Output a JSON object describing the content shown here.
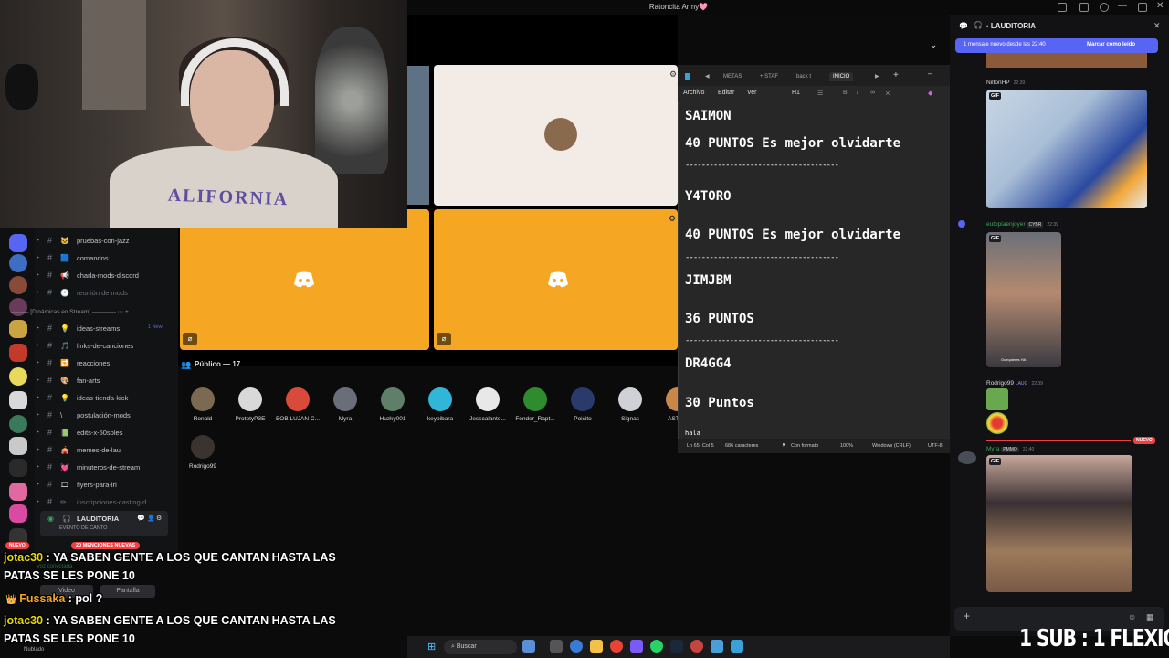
{
  "window_title": "Ratoncita Army🩷",
  "public_header": "Público — 17",
  "members": [
    {
      "name": "Ronald",
      "color": "#7b6a52"
    },
    {
      "name": "PrototyP3E",
      "color": "#d9d9d9"
    },
    {
      "name": "BOB LUJAN C...",
      "color": "#d94a3a"
    },
    {
      "name": "Myra",
      "color": "#6a6e78"
    },
    {
      "name": "Huzky001",
      "color": "#5f7f6a"
    },
    {
      "name": "keypibara",
      "color": "#2fb6d8"
    },
    {
      "name": "Jesscalante...",
      "color": "#e8e8e8"
    },
    {
      "name": "Fonder_Rapt...",
      "color": "#2e8b2e"
    },
    {
      "name": "Poicito",
      "color": "#2a3a6a"
    },
    {
      "name": "Signas",
      "color": "#cfd1d6"
    },
    {
      "name": "ASTER",
      "color": "#c9884a"
    },
    {
      "name": "Rodrigo99",
      "color": "#3a3330"
    }
  ],
  "channels": [
    {
      "emoji": "🐱",
      "name": "pruebas-con-jazz",
      "muted": false
    },
    {
      "emoji": "🟦",
      "name": "comandos",
      "muted": false
    },
    {
      "emoji": "📢",
      "name": "charla-mods-discord",
      "muted": false
    },
    {
      "emoji": "🕐",
      "name": "reunión de mods",
      "muted": true
    },
    {
      "emoji": "💡",
      "name": "ideas-streams",
      "muted": false
    },
    {
      "emoji": "🎵",
      "name": "links-de-canciones",
      "muted": false
    },
    {
      "emoji": "🔁",
      "name": "reacciones",
      "muted": false
    },
    {
      "emoji": "🎨",
      "name": "fan-arts",
      "muted": false
    },
    {
      "emoji": "💡",
      "name": "ideas-tienda-kick",
      "muted": false
    },
    {
      "emoji": "\\",
      "name": "postulación-mods",
      "muted": false
    },
    {
      "emoji": "📗",
      "name": "edits-x-50soles",
      "muted": false
    },
    {
      "emoji": "🎪",
      "name": "memes-de-lau",
      "muted": false
    },
    {
      "emoji": "💓",
      "name": "minuteros-de-stream",
      "muted": false
    },
    {
      "emoji": "🎞",
      "name": "flyers-para-irl",
      "muted": false
    },
    {
      "emoji": "✏",
      "name": "inscripciones-casting-d...",
      "muted": true
    }
  ],
  "channel_separator": "Dinámicas en Stream",
  "ideas_new_badge": "1 New",
  "voice": {
    "name": "LAUDITORIA",
    "sub": "EVENTO DE CANTO",
    "connected": "Voz conectada",
    "video": "Video",
    "screen": "Pantalla"
  },
  "badges": {
    "nuevo": "NUEVO",
    "mentions": "20 MENCIONES NUEVAS"
  },
  "overlay_chat": [
    {
      "user": "jotac30",
      "line1": " : YA SABEN GENTE A LOS QUE CANTAN HASTA LAS",
      "line2": "PATAS SE LES PONE 10"
    },
    {
      "user": "Fussaka",
      "line1": " : pol ?"
    },
    {
      "user": "jotac30",
      "line1": " : YA SABEN GENTE A LOS QUE CANTAN HASTA LAS",
      "line2": "PATAS SE LES PONE 10"
    }
  ],
  "editor": {
    "tabs": [
      "METAS",
      "+ STAF",
      "back t",
      "INICIO"
    ],
    "menu": [
      "Archivo",
      "Editar",
      "Ver"
    ],
    "heading": "H1",
    "lines": [
      {
        "text": "SAIMON"
      },
      {
        "text": "40 PUNTOS Es mejor olvidarte"
      },
      {
        "text": "Y4TORO"
      },
      {
        "text": "40 PUNTOS Es mejor olvidarte"
      },
      {
        "text": "JIMJBM"
      },
      {
        "text": "36 PUNTOS"
      },
      {
        "text": "DR4GG4"
      },
      {
        "text": "30 Puntos"
      }
    ],
    "rule": "--------------------------------------",
    "cursor_text": "hala",
    "status": {
      "pos": "Ln 65, Col 5",
      "chars": "686 caracteres",
      "format": "Con formato",
      "zoom": "100%",
      "eol": "Windows (CRLF)",
      "enc": "UTF-8"
    }
  },
  "chat": {
    "channel": "LAUDITORIA",
    "new_msg": "1 mensaje nuevo desde las 22:40",
    "mark_read": "Marcar como leído",
    "messages": [
      {
        "user": "NiltonHP",
        "time": "22:39"
      },
      {
        "user": "eutopiaenjoyer",
        "tag": "CYBR",
        "time": "22:39"
      },
      {
        "user": "Rodrigo99",
        "tag": "LAUG",
        "time": "22:39"
      },
      {
        "user": "Myra",
        "tag": "PMMO",
        "time": "22:40"
      }
    ],
    "gif_label": "GIF",
    "nuevo": "NUEVO",
    "caption": "Ouequieres HA"
  },
  "taskbar": {
    "search": "Buscar",
    "weather": "Nublado"
  },
  "overlay_sub": "1 SUB : 1 FLEXIÓN"
}
